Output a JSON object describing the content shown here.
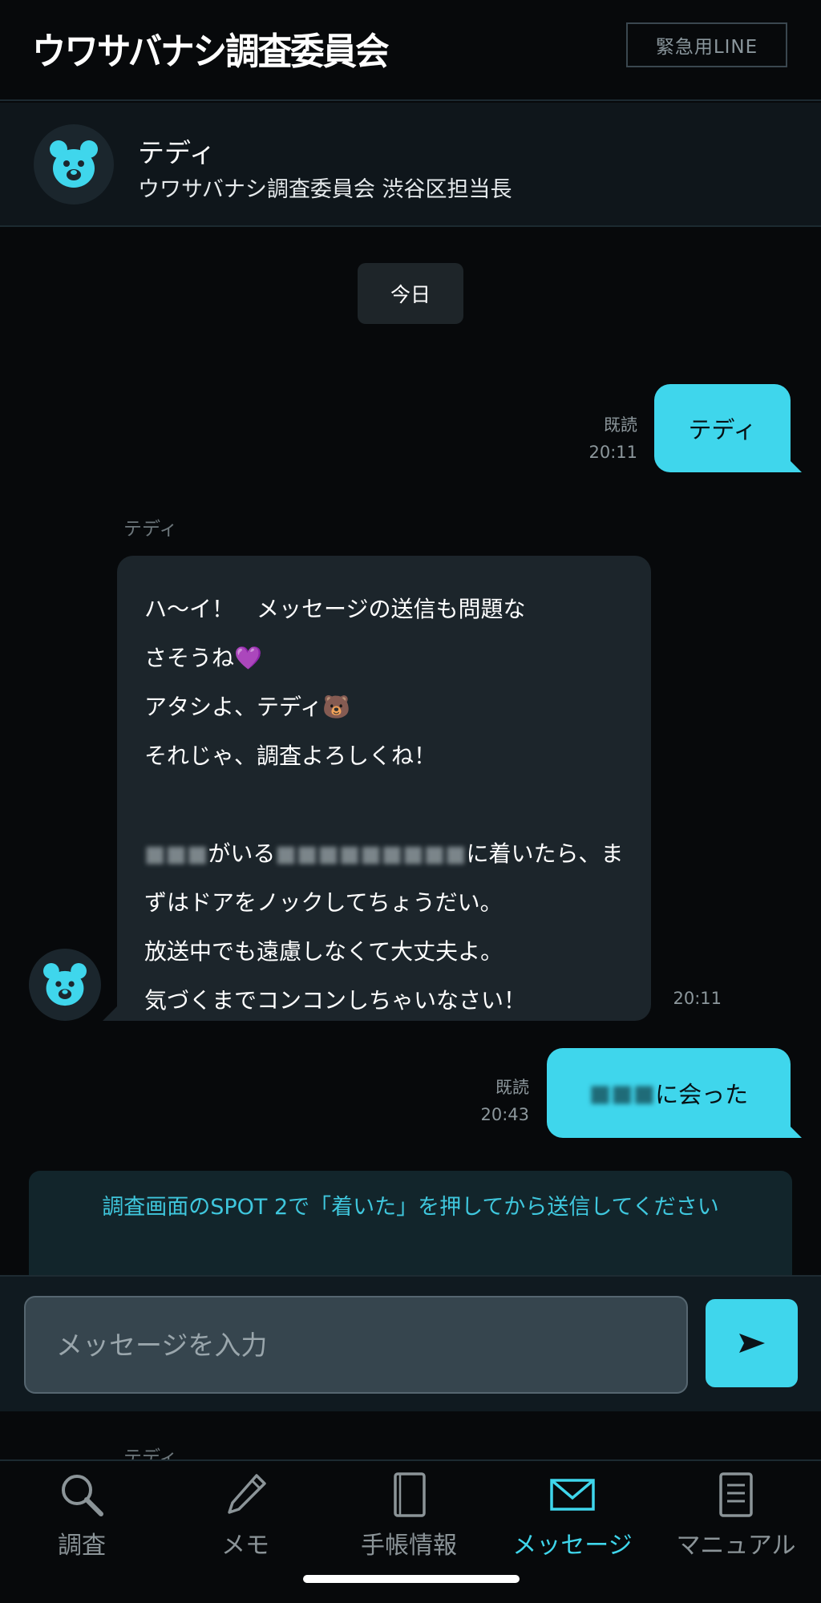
{
  "header": {
    "logo_text": "ウワサバナシ調査委員会",
    "emergency_button": "緊急用LINE"
  },
  "contact": {
    "name": "テディ",
    "role": "ウワサバナシ調査委員会 渋谷区担当長"
  },
  "chat": {
    "date_chip": "今日",
    "messages": [
      {
        "direction": "out",
        "text": "テディ",
        "read": "既読",
        "time": "20:11"
      },
      {
        "direction": "in",
        "sender": "テディ",
        "time": "20:11",
        "lines": [
          "ハ〜イ！　メッセージの送信も問題な",
          "さそうね💜",
          "アタシよ、テディ🐻",
          "それじゃ、調査よろしくね！",
          "",
          "がいる",
          "に着いたら、ま",
          "ずはドアをノックしてちょうだい。",
          "放送中でも遠慮しなくて大丈夫よ。",
          "気づくまでコンコンしちゃいなさい！"
        ]
      },
      {
        "direction": "out",
        "text": "に会った",
        "read": "既読",
        "time": "20:43"
      }
    ],
    "notice": "調査画面のSPOT 2で「着いた」を押してから送信してください",
    "next_sender": "テディ"
  },
  "input": {
    "placeholder": "メッセージを入力",
    "value": ""
  },
  "tabs": [
    {
      "label": "調査",
      "icon": "magnifier-icon",
      "active": false
    },
    {
      "label": "メモ",
      "icon": "pen-icon",
      "active": false
    },
    {
      "label": "手帳情報",
      "icon": "notebook-icon",
      "active": false
    },
    {
      "label": "メッセージ",
      "icon": "envelope-icon",
      "active": true
    },
    {
      "label": "マニュアル",
      "icon": "manual-list-icon",
      "active": false
    }
  ],
  "colors": {
    "accent": "#3fd6ec",
    "background": "#07090b",
    "bubble_in": "#1c252b",
    "notice_text": "#3fc7dd"
  }
}
